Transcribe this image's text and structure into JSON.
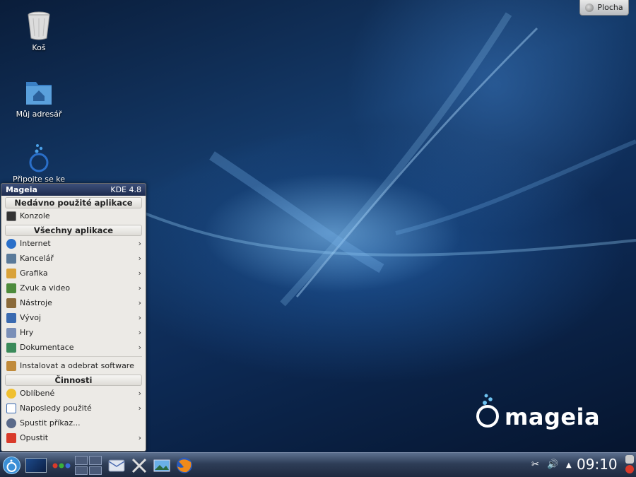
{
  "desktop": {
    "icons": [
      {
        "label": "Koš",
        "icon": "trash-icon"
      },
      {
        "label": "Můj adresář",
        "icon": "home-folder-icon"
      },
      {
        "label": "Připojte se ke",
        "icon": "network-icon"
      }
    ],
    "plocha_button": "Plocha",
    "brand": "mageia"
  },
  "menu": {
    "title": "Mageia",
    "version": "KDE 4.8",
    "recent_header": "Nedávno použité aplikace",
    "recent": [
      {
        "label": "Konzole",
        "icon": "terminal-icon"
      }
    ],
    "all_header": "Všechny aplikace",
    "apps": [
      {
        "label": "Internet",
        "icon": "globe-icon",
        "color": "#2a6fc9"
      },
      {
        "label": "Kancelář",
        "icon": "office-icon",
        "color": "#5a7a9a"
      },
      {
        "label": "Grafika",
        "icon": "graphics-icon",
        "color": "#d9a23a"
      },
      {
        "label": "Zvuk a video",
        "icon": "multimedia-icon",
        "color": "#4d8b3c"
      },
      {
        "label": "Nástroje",
        "icon": "tools-icon",
        "color": "#8a6a3a"
      },
      {
        "label": "Vývoj",
        "icon": "development-icon",
        "color": "#3a6ab0"
      },
      {
        "label": "Hry",
        "icon": "games-icon",
        "color": "#7a8fb8"
      },
      {
        "label": "Dokumentace",
        "icon": "documentation-icon",
        "color": "#3a8a5a"
      }
    ],
    "install": "Instalovat a odebrat software",
    "activities_header": "Činnosti",
    "activities": [
      {
        "label": "Oblíbené",
        "icon": "star-icon",
        "color": "#f0c030",
        "arrow": true
      },
      {
        "label": "Naposledy použité",
        "icon": "recent-icon",
        "color": "#3a6ab0",
        "arrow": true
      },
      {
        "label": "Spustit příkaz...",
        "icon": "run-icon",
        "color": "#5a6a8a",
        "arrow": false
      },
      {
        "label": "Opustit",
        "icon": "power-icon",
        "color": "#d93a2a",
        "arrow": true
      }
    ]
  },
  "taskbar": {
    "clock": "09:10",
    "tray": [
      "scissors-icon",
      "volume-icon",
      "tray-expand-icon"
    ]
  }
}
